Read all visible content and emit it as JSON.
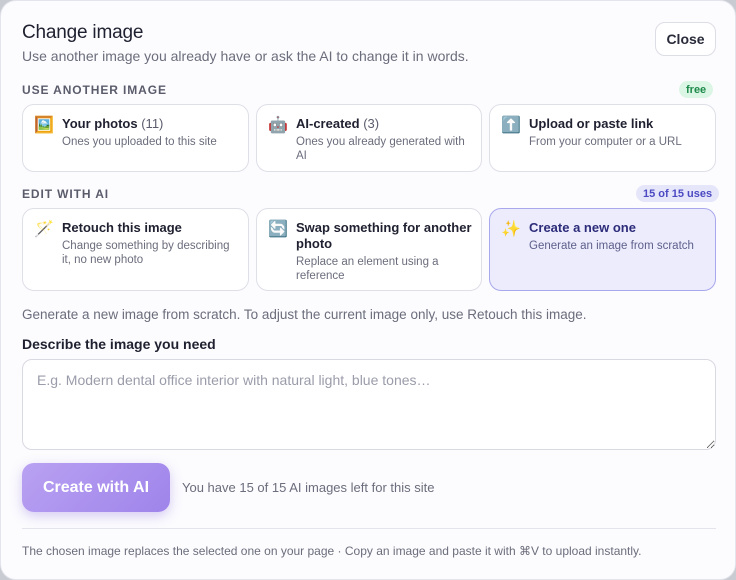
{
  "dialog": {
    "title": "Change image",
    "subtitle": "Use another image you already have or ask the AI to change it in words.",
    "close_label": "Close"
  },
  "use_another": {
    "label": "USE ANOTHER IMAGE",
    "badge": "free",
    "cards": [
      {
        "icon": "framed-picture-icon",
        "glyph": "🖼️",
        "title": "Your photos",
        "count": "(11)",
        "desc": "Ones you uploaded to this site"
      },
      {
        "icon": "robot-icon",
        "glyph": "🤖",
        "title": "AI-created",
        "count": "(3)",
        "desc": "Ones you already generated with AI"
      },
      {
        "icon": "upload-arrow-icon",
        "glyph": "⬆️",
        "title": "Upload or paste link",
        "count": "",
        "desc": "From your computer or a URL"
      }
    ]
  },
  "edit_ai": {
    "label": "EDIT WITH AI",
    "badge": "15 of 15 uses",
    "selected_index": 2,
    "cards": [
      {
        "icon": "magic-wand-icon",
        "glyph": "🪄",
        "title": "Retouch this image",
        "desc": "Change something by describing it, no new photo"
      },
      {
        "icon": "swap-arrows-icon",
        "glyph": "🔄",
        "title": "Swap something for another photo",
        "desc": "Replace an element using a reference"
      },
      {
        "icon": "sparkles-icon",
        "glyph": "✨",
        "title": "Create a new one",
        "desc": "Generate an image from scratch"
      }
    ]
  },
  "info": "Generate a new image from scratch. To adjust the current image only, use Retouch this image.",
  "prompt": {
    "label": "Describe the image you need",
    "placeholder": "E.g. Modern dental office interior with natural light, blue tones…",
    "value": ""
  },
  "create_button": "Create with AI",
  "quota_text": "You have 15 of 15 AI images left for this site",
  "footer": "The chosen image replaces the selected one on your page · Copy an image and paste it with ⌘V to upload instantly.",
  "colors": {
    "accent": "#a68bec",
    "selected_bg": "#ececfd",
    "free_badge": "#1e8a4a",
    "uses_badge": "#4b4ac2"
  }
}
